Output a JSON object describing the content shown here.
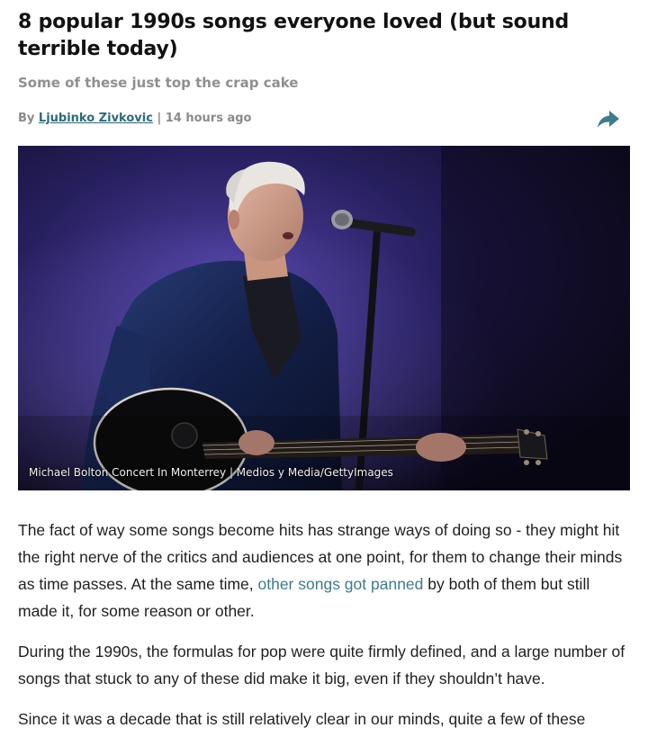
{
  "article": {
    "headline": "8 popular 1990s songs everyone loved (but sound terrible today)",
    "subheadline": "Some of these just top the crap cake",
    "byline": {
      "prefix": "By",
      "author": "Ljubinko Zivkovic",
      "separator": "|",
      "time": "14 hours ago"
    },
    "share_icon": "share-arrow-icon",
    "hero_image": {
      "subject": "musician singing into microphone while playing guitar on stage",
      "caption": "Michael Bolton Concert In Monterrey | Medios y Media/GettyImages"
    },
    "paragraphs": [
      {
        "before_link": "The fact of way some songs become hits has strange ways of doing so - they might hit the right nerve of the critics and audiences at one point, for them to change their minds as time passes. At the same time, ",
        "link_text": "other songs got panned",
        "after_link": " by both of them but still made it, for some reason or other."
      },
      {
        "text": "During the 1990s, the formulas for pop were quite firmly defined, and a large number of songs that stuck to any of these did make it big, even if they shouldn’t have."
      },
      {
        "text": "Since it was a decade that is still relatively clear in our minds, quite a few of these"
      }
    ]
  },
  "colors": {
    "link": "#2d6a78",
    "body_link": "#3f7a8a",
    "subhead": "#8f8f8f",
    "byline": "#8a8a8a",
    "headline": "#111111"
  }
}
